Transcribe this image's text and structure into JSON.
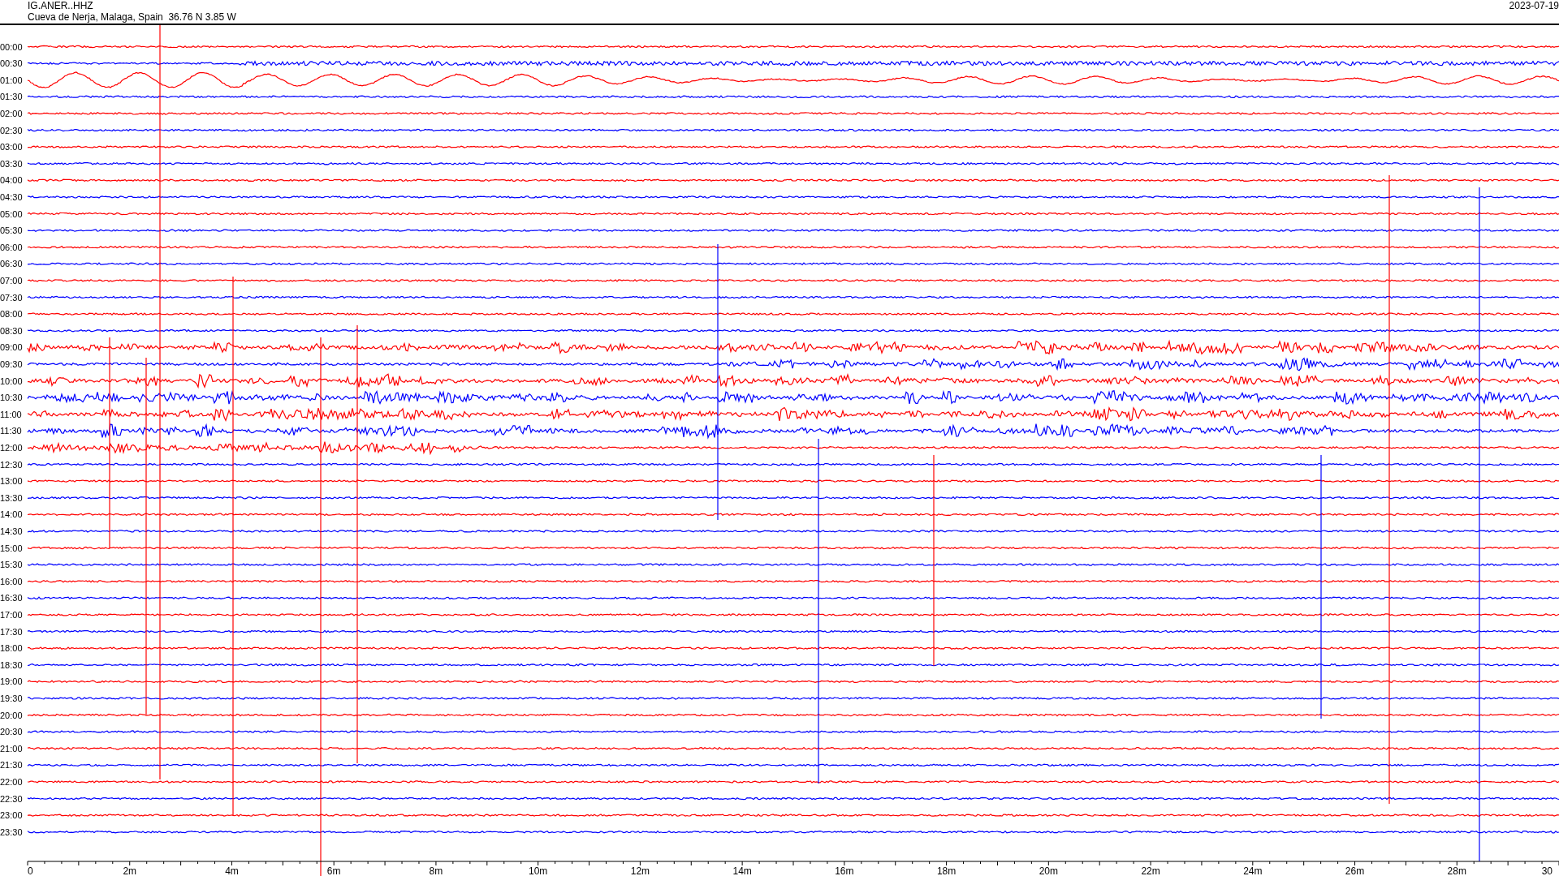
{
  "header": {
    "station": "IG.ANER..HHZ",
    "location": "Cueva de Nerja, Malaga, Spain  36.76 N 3.85 W",
    "date": "2023-07-19"
  },
  "rows": [
    {
      "label": "00:00",
      "color": "#ff0000"
    },
    {
      "label": "00:30",
      "color": "#0000ff"
    },
    {
      "label": "01:00",
      "color": "#ff0000"
    },
    {
      "label": "01:30",
      "color": "#0000ff"
    },
    {
      "label": "02:00",
      "color": "#ff0000"
    },
    {
      "label": "02:30",
      "color": "#0000ff"
    },
    {
      "label": "03:00",
      "color": "#ff0000"
    },
    {
      "label": "03:30",
      "color": "#0000ff"
    },
    {
      "label": "04:00",
      "color": "#ff0000"
    },
    {
      "label": "04:30",
      "color": "#0000ff"
    },
    {
      "label": "05:00",
      "color": "#ff0000"
    },
    {
      "label": "05:30",
      "color": "#0000ff"
    },
    {
      "label": "06:00",
      "color": "#ff0000"
    },
    {
      "label": "06:30",
      "color": "#0000ff"
    },
    {
      "label": "07:00",
      "color": "#ff0000"
    },
    {
      "label": "07:30",
      "color": "#0000ff"
    },
    {
      "label": "08:00",
      "color": "#ff0000"
    },
    {
      "label": "08:30",
      "color": "#0000ff"
    },
    {
      "label": "09:00",
      "color": "#ff0000"
    },
    {
      "label": "09:30",
      "color": "#0000ff"
    },
    {
      "label": "10:00",
      "color": "#ff0000"
    },
    {
      "label": "10:30",
      "color": "#0000ff"
    },
    {
      "label": "11:00",
      "color": "#ff0000"
    },
    {
      "label": "11:30",
      "color": "#0000ff"
    },
    {
      "label": "12:00",
      "color": "#ff0000"
    },
    {
      "label": "12:30",
      "color": "#0000ff"
    },
    {
      "label": "13:00",
      "color": "#ff0000"
    },
    {
      "label": "13:30",
      "color": "#0000ff"
    },
    {
      "label": "14:00",
      "color": "#ff0000"
    },
    {
      "label": "14:30",
      "color": "#0000ff"
    },
    {
      "label": "15:00",
      "color": "#ff0000"
    },
    {
      "label": "15:30",
      "color": "#0000ff"
    },
    {
      "label": "16:00",
      "color": "#ff0000"
    },
    {
      "label": "16:30",
      "color": "#0000ff"
    },
    {
      "label": "17:00",
      "color": "#ff0000"
    },
    {
      "label": "17:30",
      "color": "#0000ff"
    },
    {
      "label": "18:00",
      "color": "#ff0000"
    },
    {
      "label": "18:30",
      "color": "#0000ff"
    },
    {
      "label": "19:00",
      "color": "#ff0000"
    },
    {
      "label": "19:30",
      "color": "#0000ff"
    },
    {
      "label": "20:00",
      "color": "#ff0000"
    },
    {
      "label": "20:30",
      "color": "#0000ff"
    },
    {
      "label": "21:00",
      "color": "#ff0000"
    },
    {
      "label": "21:30",
      "color": "#0000ff"
    },
    {
      "label": "22:00",
      "color": "#ff0000"
    },
    {
      "label": "22:30",
      "color": "#0000ff"
    },
    {
      "label": "23:00",
      "color": "#ff0000"
    },
    {
      "label": "23:30",
      "color": "#0000ff"
    }
  ],
  "x_axis_labels": [
    "0",
    "2m",
    "4m",
    "6m",
    "8m",
    "10m",
    "12m",
    "14m",
    "16m",
    "18m",
    "20m",
    "22m",
    "24m",
    "26m",
    "28m",
    "30"
  ]
}
